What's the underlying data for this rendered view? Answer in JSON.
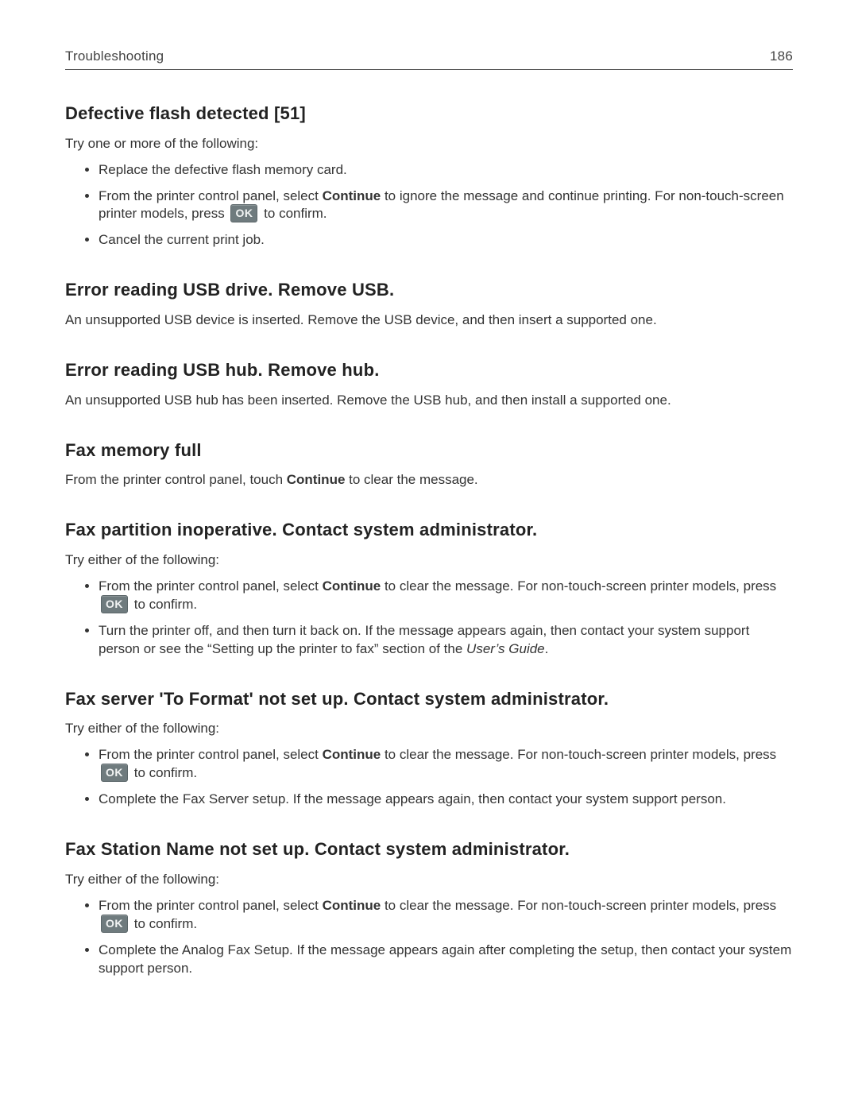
{
  "header": {
    "section": "Troubleshooting",
    "page_number": "186"
  },
  "ok_label": "OK",
  "sections": {
    "s1": {
      "title": "Defective flash detected [51]",
      "intro": "Try one or more of the following:",
      "b1": "Replace the defective flash memory card.",
      "b2a": "From the printer control panel, select ",
      "b2_bold": "Continue",
      "b2b": " to ignore the message and continue printing. For non‑touch‑screen printer models, press ",
      "b2c": " to confirm.",
      "b3": "Cancel the current print job."
    },
    "s2": {
      "title": "Error reading USB drive. Remove USB.",
      "body": "An unsupported USB device is inserted. Remove the USB device, and then insert a supported one."
    },
    "s3": {
      "title": "Error reading USB hub. Remove hub.",
      "body": "An unsupported USB hub has been inserted. Remove the USB hub, and then install a supported one."
    },
    "s4": {
      "title": "Fax memory full",
      "body_a": "From the printer control panel, touch ",
      "body_bold": "Continue",
      "body_b": " to clear the message."
    },
    "s5": {
      "title": "Fax partition inoperative. Contact system administrator.",
      "intro": "Try either of the following:",
      "b1a": "From the printer control panel, select ",
      "b1_bold": "Continue",
      "b1b": " to clear the message. For non‑touch‑screen printer models, press ",
      "b1c": " to confirm.",
      "b2a": "Turn the printer off, and then turn it back on. If the message appears again, then contact your system support person or see the “Setting up the printer to fax” section of the ",
      "b2_italic": "User’s Guide",
      "b2b": "."
    },
    "s6": {
      "title": "Fax server 'To Format' not set up. Contact system administrator.",
      "intro": "Try either of the following:",
      "b1a": "From the printer control panel, select ",
      "b1_bold": "Continue",
      "b1b": " to clear the message. For non‑touch‑screen printer models, press ",
      "b1c": " to confirm.",
      "b2": "Complete the Fax Server setup. If the message appears again, then contact your system support person."
    },
    "s7": {
      "title": "Fax Station Name not set up. Contact system administrator.",
      "intro": "Try either of the following:",
      "b1a": "From the printer control panel, select ",
      "b1_bold": "Continue",
      "b1b": " to clear the message. For non‑touch‑screen printer models, press ",
      "b1c": " to confirm.",
      "b2": "Complete the Analog Fax Setup. If the message appears again after completing the setup, then contact your system support person."
    }
  }
}
